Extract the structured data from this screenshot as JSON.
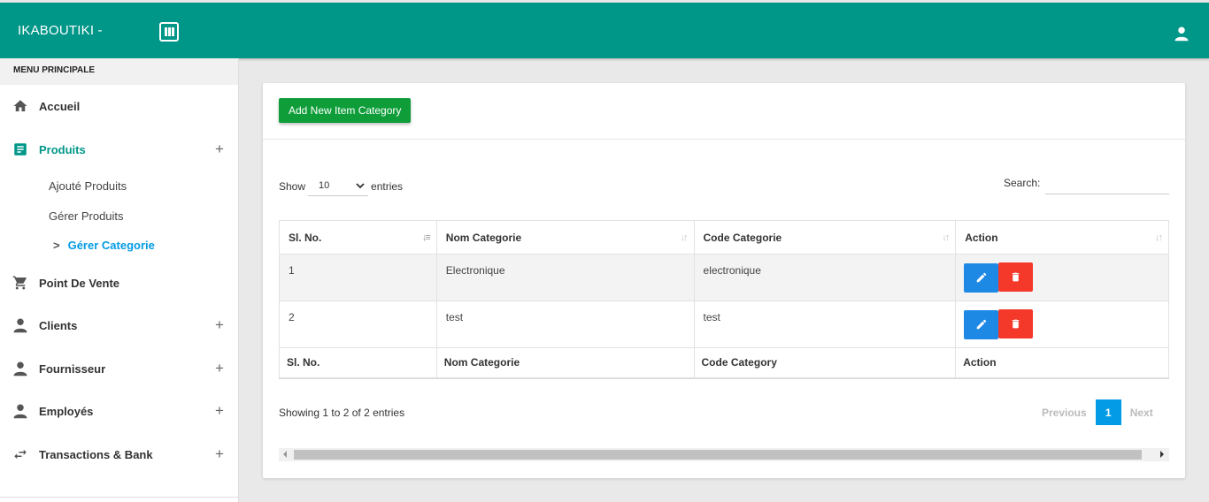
{
  "header": {
    "brand": "IKABOUTIKI -"
  },
  "sidebar": {
    "title": "MENU PRINCIPALE",
    "items": [
      {
        "label": "Accueil",
        "icon": "home-icon"
      },
      {
        "label": "Produits",
        "icon": "document-icon",
        "expand": "+"
      },
      {
        "label": "Point De Vente",
        "icon": "cart-icon"
      },
      {
        "label": "Clients",
        "icon": "person-icon",
        "expand": "+"
      },
      {
        "label": "Fournisseur",
        "icon": "person-icon",
        "expand": "+"
      },
      {
        "label": "Employés",
        "icon": "person-icon",
        "expand": "+"
      },
      {
        "label": "Transactions & Bank",
        "icon": "swap-arrows-icon",
        "expand": "+"
      }
    ],
    "produits_sub": [
      "Ajouté Produits",
      "Gérer Produits",
      "Gérer Categorie"
    ]
  },
  "main": {
    "add_button": "Add New Item Category",
    "show_label": "Show",
    "entries_value": "10",
    "entries_label": "entries",
    "search_label": "Search:",
    "table": {
      "headers": [
        "Sl. No.",
        "Nom Categorie",
        "Code Categorie",
        "Action"
      ],
      "rows": [
        {
          "sl": "1",
          "nom": "Electronique",
          "code": "electronique"
        },
        {
          "sl": "2",
          "nom": "test",
          "code": "test"
        }
      ],
      "footers": [
        "Sl. No.",
        "Nom Categorie",
        "Code Category",
        "Action"
      ]
    },
    "info": "Showing 1 to 2 of 2 entries",
    "pager": {
      "previous": "Previous",
      "current_page": "1",
      "next": "Next"
    }
  },
  "colors": {
    "header": "#009688",
    "add_button": "#0f9d3a",
    "edit_button": "#1e88e5",
    "delete_button": "#f4382a",
    "active_page": "#039be5"
  }
}
